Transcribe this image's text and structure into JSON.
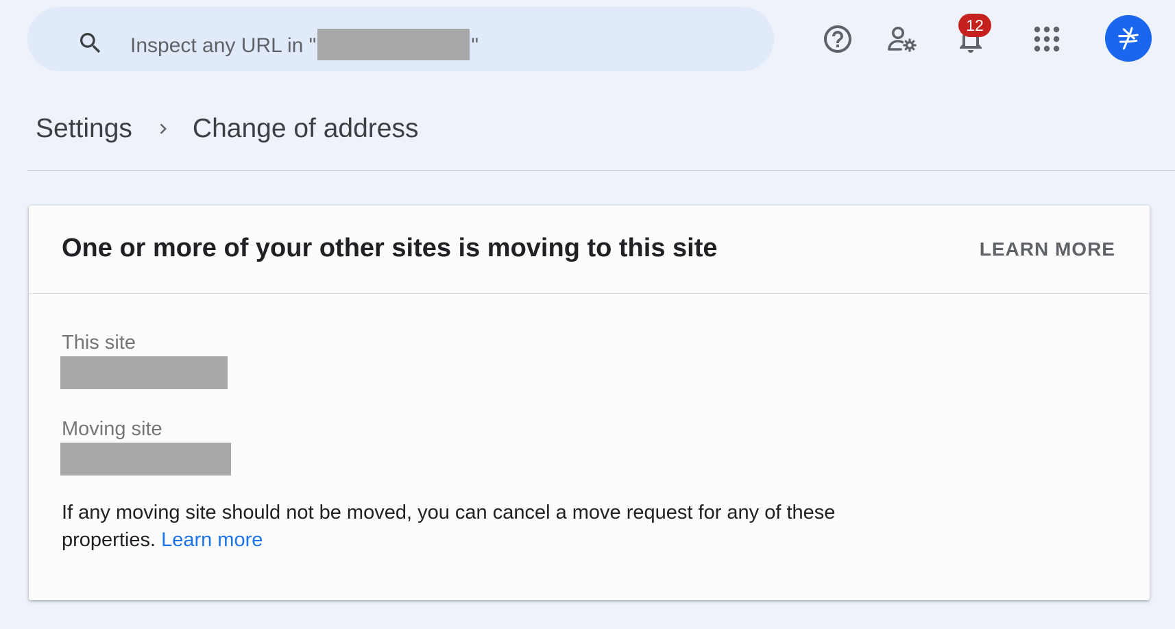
{
  "search": {
    "prefix": "Inspect any URL in \"",
    "suffix": "\""
  },
  "header": {
    "notification_count": "12",
    "icons": [
      "help-icon",
      "admin-settings-icon",
      "bell-icon",
      "apps-icon",
      "account-avatar"
    ]
  },
  "breadcrumb": {
    "parent": "Settings",
    "current": "Change of address"
  },
  "card": {
    "title": "One or more of your other sites is moving to this site",
    "learn_more_button": "LEARN MORE",
    "this_site_label": "This site",
    "moving_site_label": "Moving site",
    "body_text": "If any moving site should not be moved, you can cancel a move request for any of these properties.",
    "body_link": "Learn more"
  },
  "colors": {
    "background": "#eef2fa",
    "search_bg": "#e1eaf9",
    "badge": "#c5221f",
    "avatar": "#1a66ee",
    "link": "#1a73e8",
    "redaction": "#a8a8a8"
  }
}
